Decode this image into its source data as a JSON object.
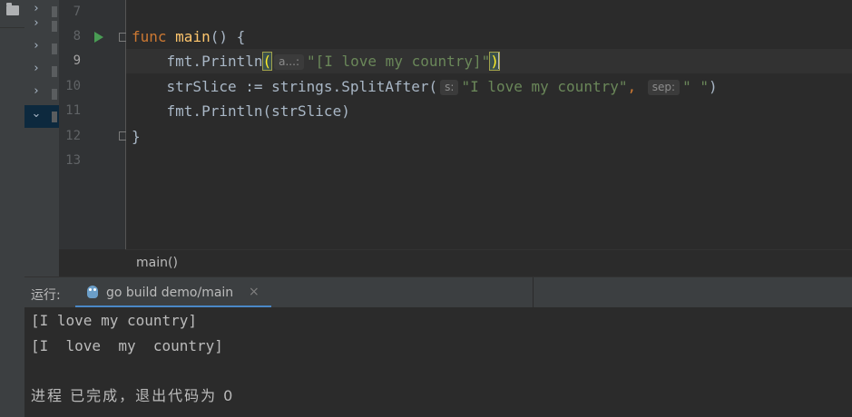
{
  "tree": {
    "rows": [
      {
        "icon": "chevron-right-icon",
        "glyph": "›",
        "selected": false
      },
      {
        "icon": "chevron-right-icon",
        "glyph": "›",
        "selected": false
      },
      {
        "icon": "chevron-right-icon",
        "glyph": "›",
        "selected": false
      },
      {
        "icon": "chevron-right-icon",
        "glyph": "›",
        "selected": false
      },
      {
        "icon": "chevron-right-icon",
        "glyph": "›",
        "selected": false
      },
      {
        "icon": "chevron-down-icon",
        "glyph": "⌄",
        "selected": true
      }
    ]
  },
  "gutter": {
    "line_numbers": [
      "7",
      "8",
      "9",
      "10",
      "11",
      "12",
      "13"
    ],
    "current_line": "9"
  },
  "editor": {
    "line8": {
      "kw": "func",
      "fn": "main",
      "rest": "() {"
    },
    "line9": {
      "pkg": "fmt.",
      "call": "Println",
      "open": "(",
      "hint": "a...:",
      "arg": "\"[I love my country]\"",
      "close": ")"
    },
    "line10": {
      "lhs": "strSlice := strings.",
      "call": "SplitAfter",
      "open": "(",
      "hint1": "s:",
      "arg1": "\"I love my country\"",
      "comma": ",",
      "hint2": "sep:",
      "arg2": "\" \"",
      "close": ")"
    },
    "line11": {
      "pkg": "fmt.",
      "call": "Println",
      "rest": "(strSlice)"
    },
    "line12": {
      "text": "}"
    }
  },
  "breadcrumb": {
    "text": "main()"
  },
  "run": {
    "label": "运行:",
    "tab_title": "go build demo/main",
    "tab_close": "×"
  },
  "console": {
    "lines": [
      "[I love my country]",
      "[I  love  my  country]",
      "",
      "进程 已完成，退出代码为 0"
    ]
  },
  "colors": {
    "accent": "#4a88c7",
    "keyword": "#cc7832",
    "function": "#ffc66d",
    "string": "#6a8759",
    "run_icon": "#499c54"
  }
}
